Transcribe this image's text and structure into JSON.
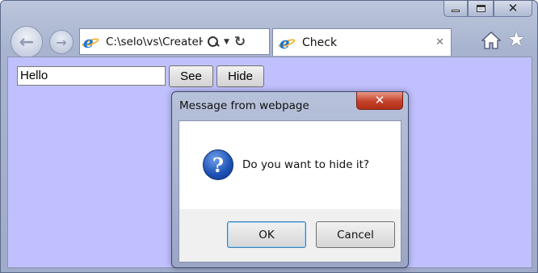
{
  "browser": {
    "address": "C:\\selo\\vs\\CreateH",
    "tab_title": "Check",
    "tab_close": "✕",
    "back_arrow": "←",
    "forward_arrow": "→",
    "refresh": "↻",
    "dropdown": "▼",
    "star": "★"
  },
  "page": {
    "input_value": "Hello",
    "see_label": "See",
    "hide_label": "Hide",
    "background_color": "#c0c0ff"
  },
  "dialog": {
    "title": "Message from webpage",
    "message": "Do you want to hide it?",
    "question_glyph": "?",
    "ok_label": "OK",
    "cancel_label": "Cancel"
  }
}
